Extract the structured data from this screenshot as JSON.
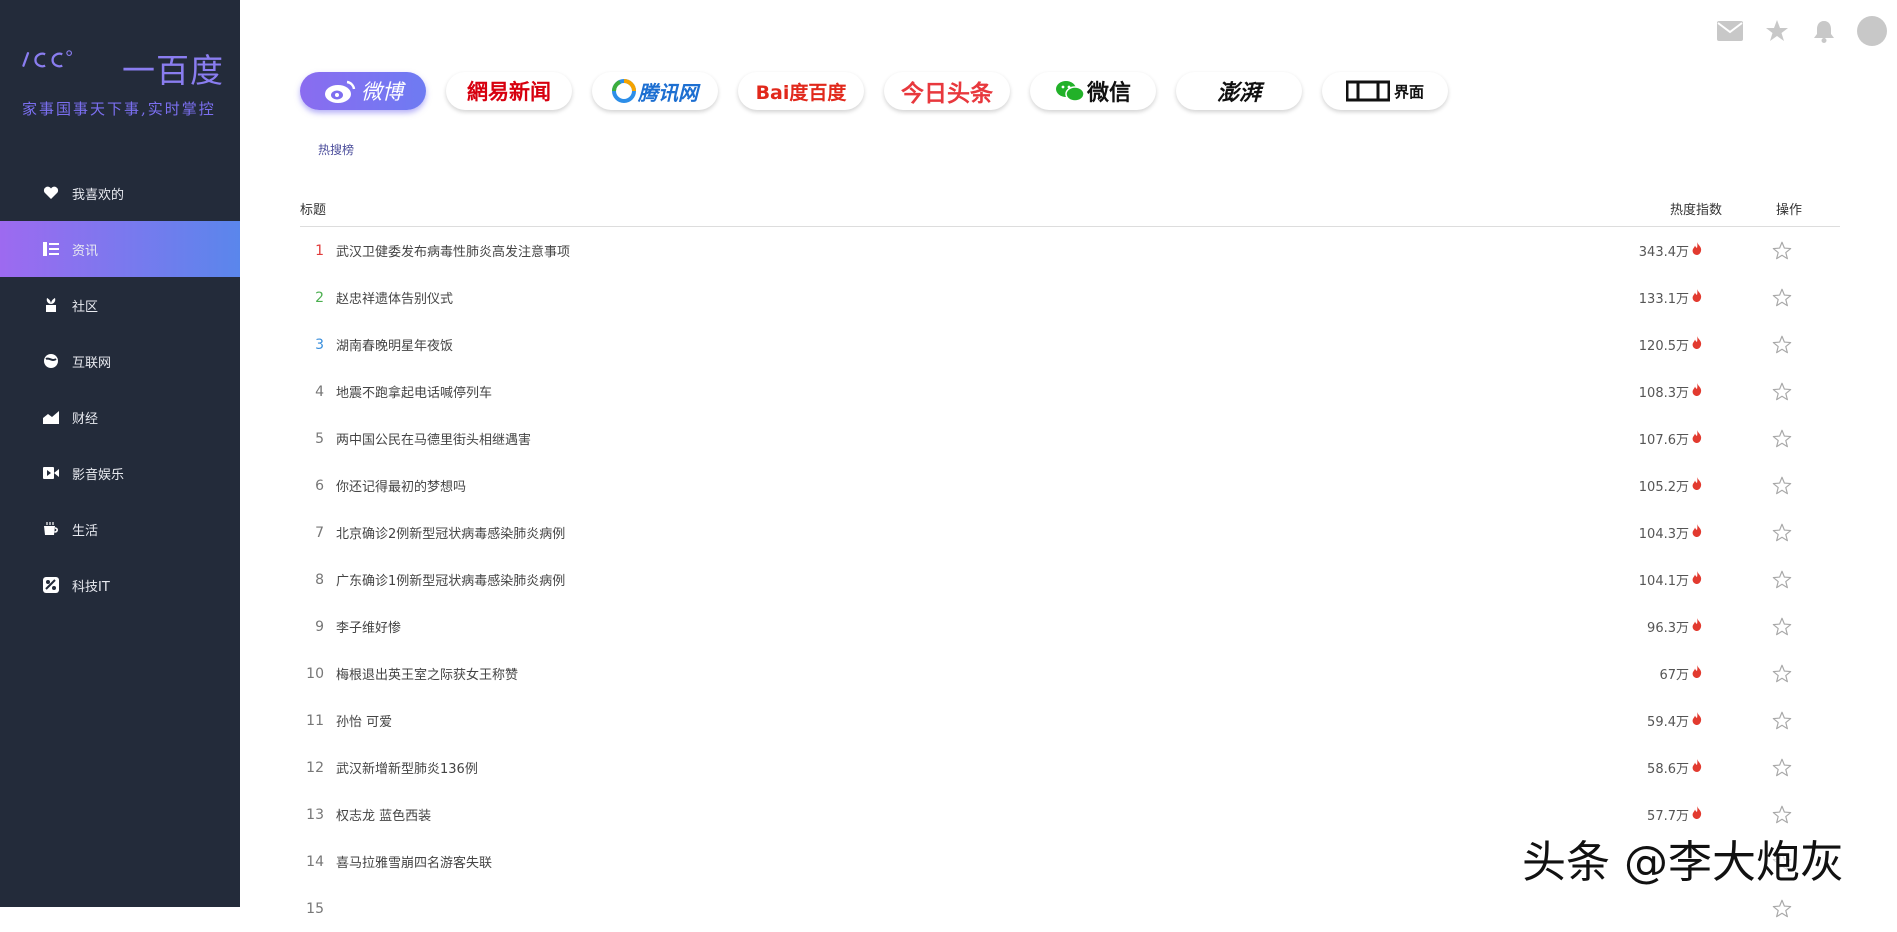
{
  "brand": {
    "logo_letters": "ICC",
    "name": "一百度",
    "tagline": "家事国事天下事,实时掌控",
    "accent": "#8a7df0"
  },
  "sidebar": {
    "items": [
      {
        "label": "我喜欢的",
        "icon": "heart-icon",
        "active": false
      },
      {
        "label": "资讯",
        "icon": "news-icon",
        "active": true
      },
      {
        "label": "社区",
        "icon": "community-icon",
        "active": false
      },
      {
        "label": "互联网",
        "icon": "internet-icon",
        "active": false
      },
      {
        "label": "财经",
        "icon": "finance-icon",
        "active": false
      },
      {
        "label": "影音娱乐",
        "icon": "video-icon",
        "active": false
      },
      {
        "label": "生活",
        "icon": "coffee-icon",
        "active": false
      },
      {
        "label": "科技IT",
        "icon": "tech-icon",
        "active": false
      }
    ]
  },
  "topbar": {
    "icons": [
      "mail-icon",
      "star-icon",
      "bell-icon",
      "avatar"
    ]
  },
  "sources": [
    {
      "label": "微博",
      "active": true
    },
    {
      "label": "網易新闻",
      "active": false
    },
    {
      "label": "腾讯网",
      "active": false
    },
    {
      "label": "Bai度百度",
      "active": false
    },
    {
      "label": "今日头条",
      "active": false
    },
    {
      "label": "微信",
      "active": false
    },
    {
      "label": "澎湃",
      "active": false
    },
    {
      "label": "界面",
      "active": false
    }
  ],
  "subtab": "热搜榜",
  "table": {
    "headers": {
      "title": "标题",
      "heat": "热度指数",
      "op": "操作"
    },
    "rows": [
      {
        "rank": "1",
        "title": "武汉卫健委发布病毒性肺炎高发注意事项",
        "heat": "343.4万"
      },
      {
        "rank": "2",
        "title": "赵忠祥遗体告别仪式",
        "heat": "133.1万"
      },
      {
        "rank": "3",
        "title": "湖南春晚明星年夜饭",
        "heat": "120.5万"
      },
      {
        "rank": "4",
        "title": "地震不跑拿起电话喊停列车",
        "heat": "108.3万"
      },
      {
        "rank": "5",
        "title": "两中国公民在马德里街头相继遇害",
        "heat": "107.6万"
      },
      {
        "rank": "6",
        "title": "你还记得最初的梦想吗",
        "heat": "105.2万"
      },
      {
        "rank": "7",
        "title": "北京确诊2例新型冠状病毒感染肺炎病例",
        "heat": "104.3万"
      },
      {
        "rank": "8",
        "title": "广东确诊1例新型冠状病毒感染肺炎病例",
        "heat": "104.1万"
      },
      {
        "rank": "9",
        "title": "李子维好惨",
        "heat": "96.3万"
      },
      {
        "rank": "10",
        "title": "梅根退出英王室之际获女王称赞",
        "heat": "67万"
      },
      {
        "rank": "11",
        "title": "孙怡 可爱",
        "heat": "59.4万"
      },
      {
        "rank": "12",
        "title": "武汉新增新型肺炎136例",
        "heat": "58.6万"
      },
      {
        "rank": "13",
        "title": "权志龙 蓝色西装",
        "heat": "57.7万"
      },
      {
        "rank": "14",
        "title": "喜马拉雅雪崩四名游客失联",
        "heat": ""
      },
      {
        "rank": "15",
        "title": "",
        "heat": ""
      }
    ]
  },
  "watermark": "头条 @李大炮灰"
}
